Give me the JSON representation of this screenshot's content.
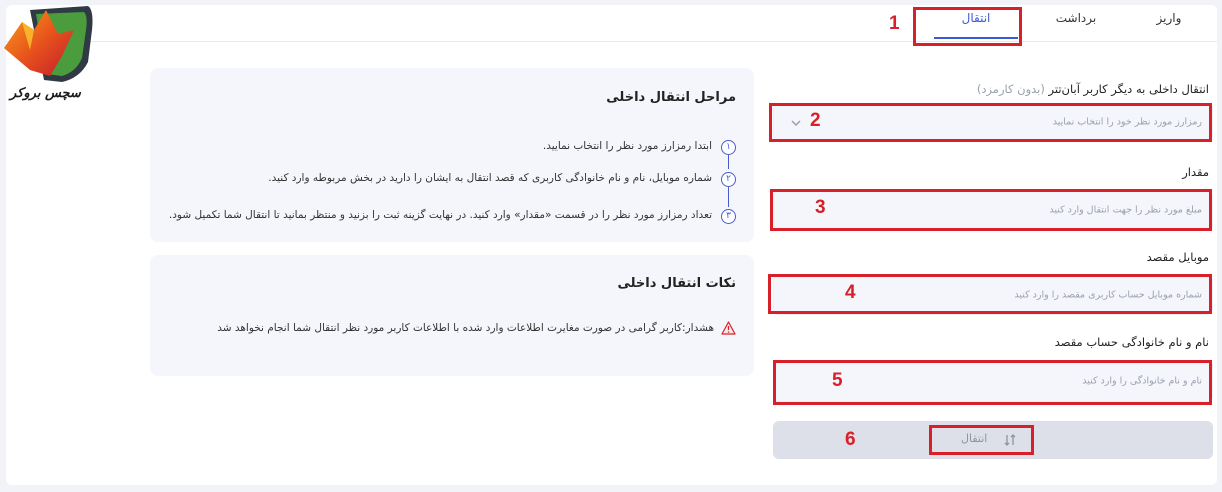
{
  "brand": {
    "name": "سچس بروکر"
  },
  "tabs": [
    {
      "label": "واریز"
    },
    {
      "label": "برداشت"
    },
    {
      "label": "انتقال",
      "active": true
    }
  ],
  "form": {
    "crypto_label": "انتقال داخلی به دیگر کاربر آبان‌تتر",
    "crypto_label_note": "(بدون کارمزد)",
    "crypto_placeholder": "رمزارز مورد نظر خود را انتخاب نمایید",
    "amount_label": "مقدار",
    "amount_placeholder": "مبلغ مورد نظر را جهت انتقال وارد کنید",
    "mobile_label": "موبایل مقصد",
    "mobile_placeholder": "شماره موبایل حساب کاربری مقصد را وارد کنید",
    "name_label": "نام و نام خانوادگی حساب مقصد",
    "name_placeholder": "نام و نام خانوادگی را وارد کنید",
    "submit_label": "انتقال"
  },
  "steps_panel": {
    "title": "مراحل انتقال داخلی",
    "steps": [
      {
        "num": "۱",
        "text": "ابتدا رمزارز مورد نظر را انتخاب نمایید."
      },
      {
        "num": "۲",
        "text": "شماره موبایل، نام و نام خانوادگی کاربری که قصد انتقال به ایشان را دارید در بخش مربوطه وارد کنید."
      },
      {
        "num": "۳",
        "text": "تعداد رمزارز مورد نظر را در قسمت «مقدار» وارد کنید. در نهایت گزینه ثبت را بزنید و منتظر بمانید تا انتقال شما تکمیل شود."
      }
    ]
  },
  "notes_panel": {
    "title": "نکات انتقال داخلی",
    "warning": "هشدار:کاربر گرامی در صورت مغایرت اطلاعات وارد شده با اطلاعات کاربر مورد نظر انتقال شما انجام نخواهد شد"
  },
  "annotations": [
    "1",
    "2",
    "3",
    "4",
    "5",
    "6"
  ],
  "colors": {
    "accent": "#3a5bd8",
    "annotation": "#d8202a",
    "panel_bg": "#f4f6fb"
  }
}
